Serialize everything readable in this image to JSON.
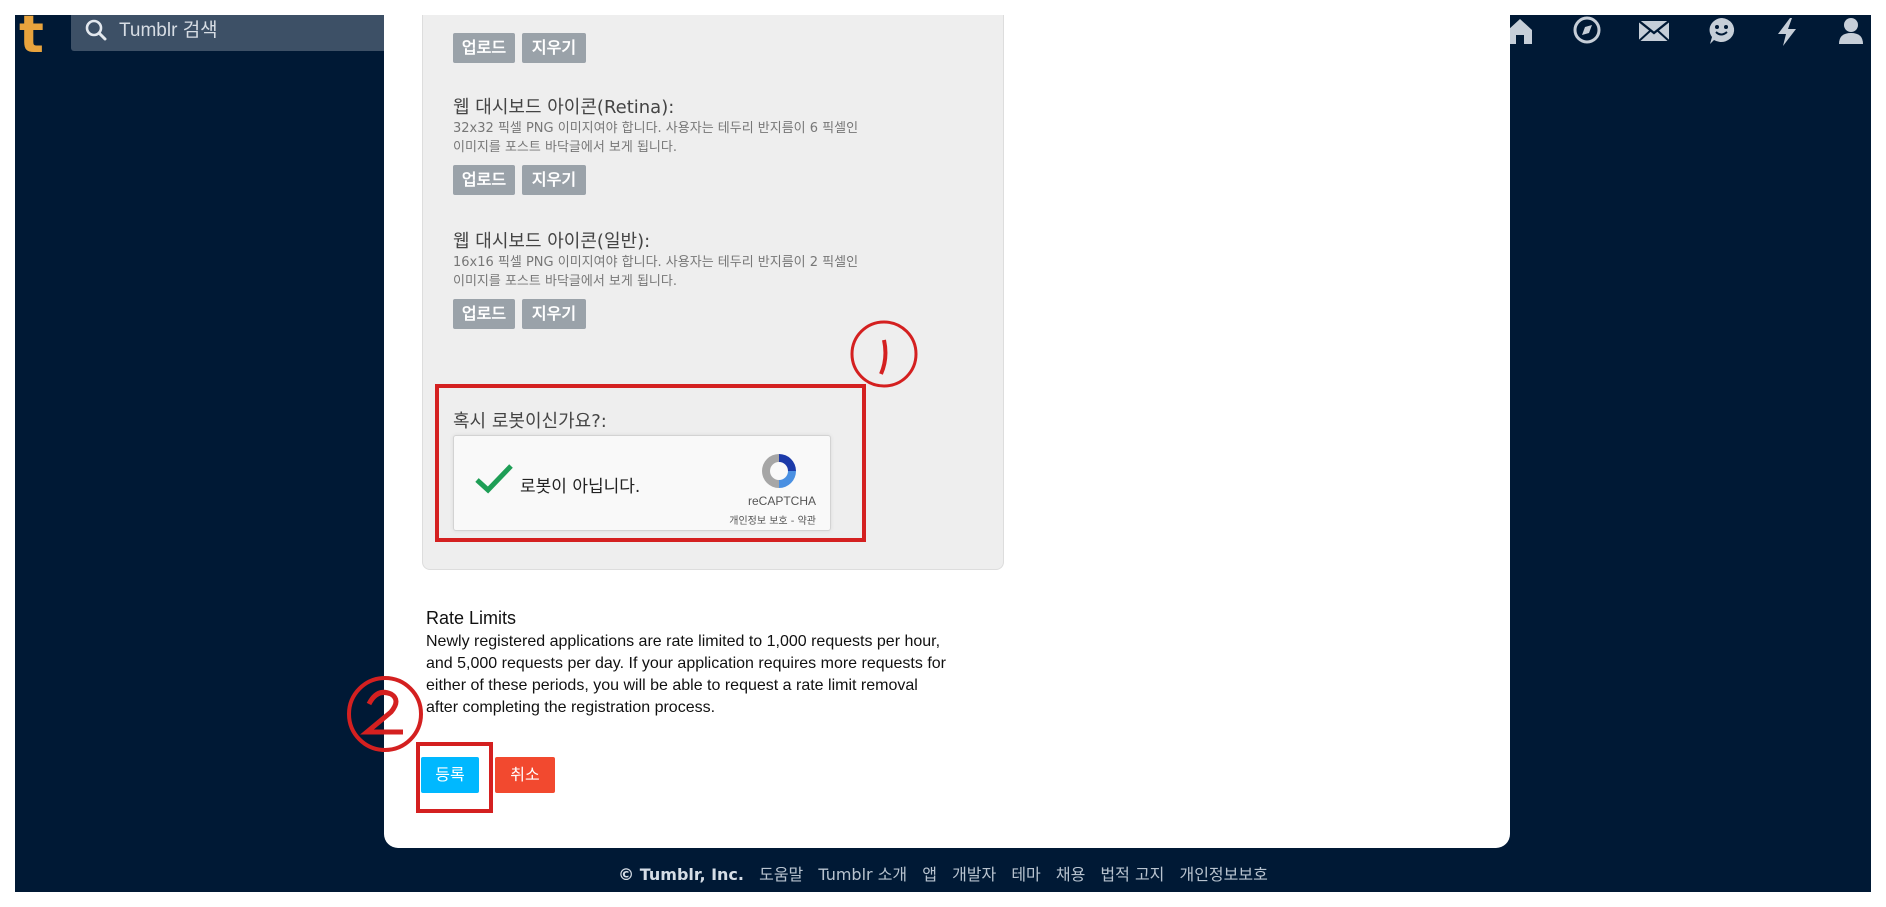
{
  "topbar": {
    "logo": "t",
    "search_placeholder": "Tumblr 검색",
    "icons": [
      "home-icon",
      "explore-icon",
      "inbox-icon",
      "messaging-icon",
      "activity-icon",
      "account-icon"
    ]
  },
  "panel": {
    "top_buttons": {
      "upload": "업로드",
      "clear": "지우기"
    },
    "retina": {
      "title": "웹 대시보드 아이콘(Retina):",
      "desc": "32x32 픽셀 PNG 이미지여야 합니다. 사용자는 테두리 반지름이 6 픽셀인 이미지를 포스트 바닥글에서 보게 됩니다.",
      "upload": "업로드",
      "clear": "지우기"
    },
    "normal": {
      "title": "웹 대시보드 아이콘(일반):",
      "desc": "16x16 픽셀 PNG 이미지여야 합니다. 사용자는 테두리 반지름이 2 픽셀인 이미지를 포스트 바닥글에서 보게 됩니다.",
      "upload": "업로드",
      "clear": "지우기"
    },
    "robot_label": "혹시 로봇이신가요?:",
    "captcha": {
      "text": "로봇이 아닙니다.",
      "brand": "reCAPTCHA",
      "links": "개인정보 보호 - 약관",
      "checked": true
    }
  },
  "rate_limits": {
    "title": "Rate Limits",
    "body": "Newly registered applications are rate limited to 1,000 requests per hour, and 5,000 requests per day. If your application requires more requests for either of these periods, you will be able to request a rate limit removal after completing the registration process."
  },
  "actions": {
    "submit": "등록",
    "cancel": "취소"
  },
  "footer": {
    "copyright": "© Tumblr, Inc.",
    "links": [
      "도움말",
      "Tumblr 소개",
      "앱",
      "개발자",
      "테마",
      "채용",
      "법적 고지",
      "개인정보보호"
    ]
  },
  "colors": {
    "background": "#001935",
    "logo": "#e8a33d",
    "submit": "#00b8ff",
    "cancel": "#f2492f",
    "annotation": "#d42020"
  }
}
